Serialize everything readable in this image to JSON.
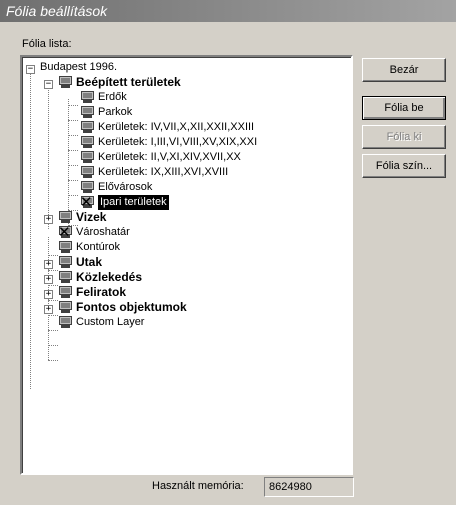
{
  "window": {
    "title": "Fólia beállítások"
  },
  "tree_label": "Fólia lista:",
  "tree": {
    "root": "Budapest 1996.",
    "beepitett": "Beépített területek",
    "erdok": "Erdők",
    "parkok": "Parkok",
    "ker1": "Kerületek: IV,VII,X,XII,XXII,XXIII",
    "ker2": "Kerületek: I,III,VI,VIII,XV,XIX,XXI",
    "ker3": "Kerületek: II,V,XI,XIV,XVII,XX",
    "ker4": "Kerületek: IX,XIII,XVI,XVIII",
    "elovarosok": "Elővárosok",
    "ipari": "Ipari területek",
    "vizek": "Vizek",
    "varoshatar": "Városhatár",
    "konturok": "Kontúrok",
    "utak": "Utak",
    "kozlekedes": "Közlekedés",
    "feliratok": "Feliratok",
    "fontos": "Fontos objektumok",
    "custom": "Custom Layer"
  },
  "buttons": {
    "bezar": "Bezár",
    "folia_be": "Fólia be",
    "folia_ki": "Fólia ki",
    "folia_szin": "Fólia szín..."
  },
  "memory": {
    "label": "Használt memória:",
    "value": "8624980"
  }
}
